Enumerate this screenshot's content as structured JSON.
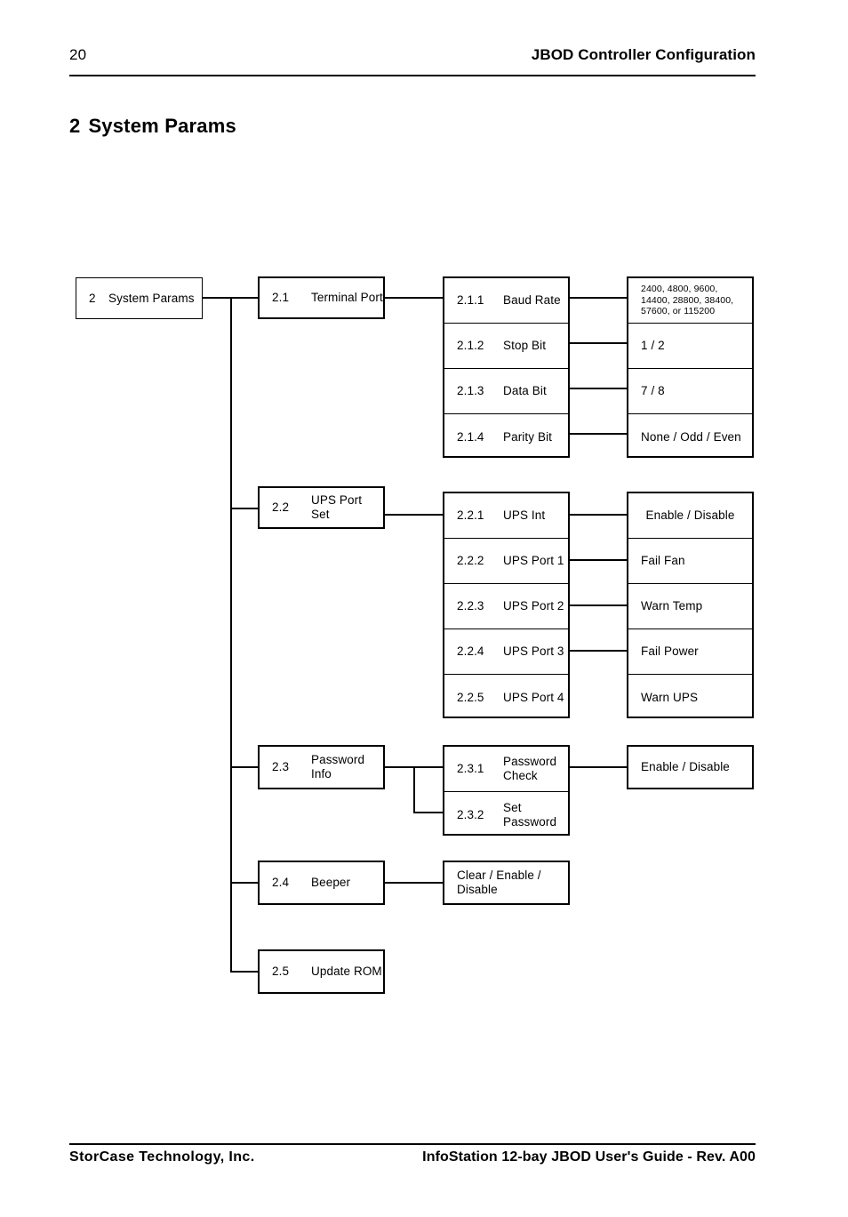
{
  "header": {
    "page_number": "20",
    "running_title": "JBOD Controller Configuration"
  },
  "heading": {
    "number": "2",
    "title": "System Params"
  },
  "footer": {
    "company": "StorCase Technology, Inc.",
    "document": "InfoStation 12-bay JBOD User's Guide - Rev. A00"
  },
  "diagram": {
    "root": {
      "index": "2",
      "label": "System Params"
    },
    "terminal_port": {
      "parent": {
        "index": "2.1",
        "label": "Terminal Port"
      },
      "items": [
        {
          "index": "2.1.1",
          "label": "Baud Rate"
        },
        {
          "index": "2.1.2",
          "label": "Stop Bit"
        },
        {
          "index": "2.1.3",
          "label": "Data Bit"
        },
        {
          "index": "2.1.4",
          "label": "Parity Bit"
        }
      ],
      "values": [
        "2400, 4800, 9600,\n14400, 28800, 38400,\n57600, or 115200",
        "1 / 2",
        "7 / 8",
        "None / Odd / Even"
      ]
    },
    "ups_port_set": {
      "parent": {
        "index": "2.2",
        "label": "UPS Port\nSet"
      },
      "items": [
        {
          "index": "2.2.1",
          "label": "UPS Int"
        },
        {
          "index": "2.2.2",
          "label": "UPS Port 1"
        },
        {
          "index": "2.2.3",
          "label": "UPS Port 2"
        },
        {
          "index": "2.2.4",
          "label": "UPS Port 3"
        },
        {
          "index": "2.2.5",
          "label": "UPS Port 4"
        }
      ],
      "values": [
        "Enable / Disable",
        "Fail Fan",
        "Warn Temp",
        "Fail Power",
        "Warn UPS"
      ]
    },
    "password_info": {
      "parent": {
        "index": "2.3",
        "label": "Password\nInfo"
      },
      "items": [
        {
          "index": "2.3.1",
          "label": "Password\nCheck"
        },
        {
          "index": "2.3.2",
          "label": "Set\nPassword"
        }
      ],
      "values": [
        "Enable / Disable"
      ]
    },
    "beeper": {
      "parent": {
        "index": "2.4",
        "label": "Beeper"
      },
      "values": [
        "Clear / Enable /\nDisable"
      ]
    },
    "update_rom": {
      "parent": {
        "index": "2.5",
        "label": "Update ROM"
      }
    }
  }
}
